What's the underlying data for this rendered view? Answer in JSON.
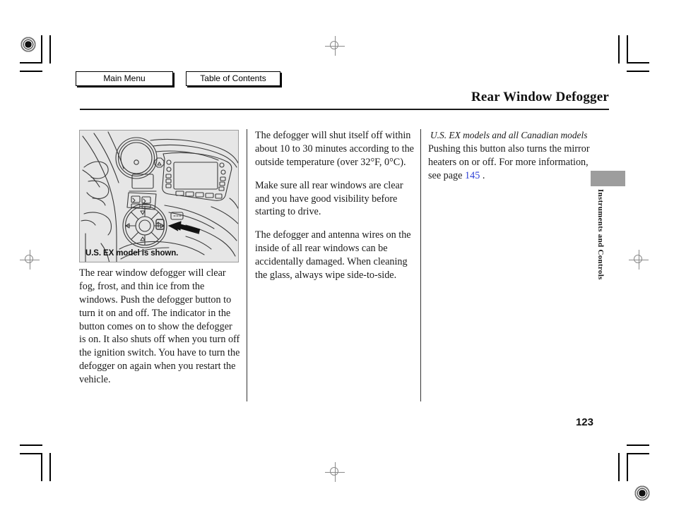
{
  "nav": {
    "main_menu": "Main Menu",
    "table_of_contents": "Table of Contents"
  },
  "header": {
    "title": "Rear Window Defogger"
  },
  "figure": {
    "caption": "U.S. EX model is shown.",
    "alt_name": "dashboard-center-console-illustration"
  },
  "columns": {
    "left": {
      "paragraph1": "The rear window defogger will clear fog, frost, and thin ice from the windows. Push the defogger button to turn it on and off. The indicator in the button comes on to show the defogger is on. It also shuts off when you turn off the ignition switch. You have to turn the defogger on again when you restart the vehicle."
    },
    "middle": {
      "paragraph1": "The defogger will shut itself off within about 10 to 30 minutes according to the outside temperature (over 32°F, 0°C).",
      "paragraph2": "Make sure all rear windows are clear and you have good visibility before starting to drive.",
      "paragraph3": "The defogger and antenna wires on the inside of all rear windows can be accidentally damaged. When cleaning the glass, always wipe side-to-side."
    },
    "right": {
      "subheading": "U.S. EX models and all Canadian models",
      "paragraph1_before": "Pushing this button also turns the mirror heaters on or off. For more information, see page ",
      "page_reference": "145",
      "paragraph1_after": " ."
    }
  },
  "side_tab": {
    "label": "Instruments and Controls"
  },
  "footer": {
    "page_number": "123"
  },
  "colors": {
    "link": "#2b3fd6",
    "figure_background": "#e6e6e6",
    "tab_block": "#9d9d9d",
    "text": "#1a1a1a"
  }
}
